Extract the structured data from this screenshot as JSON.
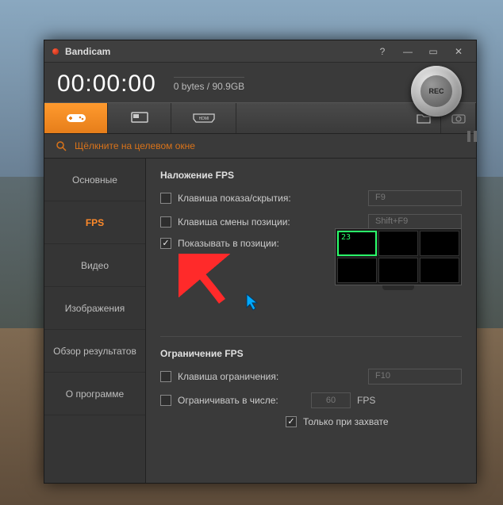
{
  "app": {
    "title": "Bandicam"
  },
  "window_controls": {
    "help": "?",
    "min": "—",
    "max": "▭",
    "close": "✕"
  },
  "header": {
    "timer": "00:00:00",
    "status_line": "0 bytes / 90.9GB",
    "rec_label": "REC"
  },
  "modetabs": {
    "game_icon": "gamepad-icon",
    "screen_icon": "monitor-icon",
    "hdmi_icon": "hdmi-icon",
    "folder_icon": "folder-icon",
    "camera_icon": "camera-icon"
  },
  "targetbar": {
    "text": "Щёлкните на целевом окне"
  },
  "sidebar": {
    "items": [
      {
        "label": "Основные"
      },
      {
        "label": "FPS"
      },
      {
        "label": "Видео"
      },
      {
        "label": "Изображения"
      },
      {
        "label": "Обзор результатов"
      },
      {
        "label": "О программе"
      }
    ],
    "active_index": 1
  },
  "panel": {
    "section1_title": "Наложение FPS",
    "row_show_hide_label": "Клавиша показа/скрытия:",
    "row_show_hide_hotkey": "F9",
    "row_change_pos_label": "Клавиша смены позиции:",
    "row_change_pos_hotkey": "Shift+F9",
    "row_show_in_pos_label": "Показывать в позиции:",
    "monitor_fps_sample": "23",
    "section2_title": "Ограничение FPS",
    "row_limit_key_label": "Клавиша ограничения:",
    "row_limit_key_hotkey": "F10",
    "row_limit_to_label": "Ограничивать в числе:",
    "row_limit_value": "60",
    "fps_suffix": "FPS",
    "row_only_capture_label": "Только при захвате"
  }
}
